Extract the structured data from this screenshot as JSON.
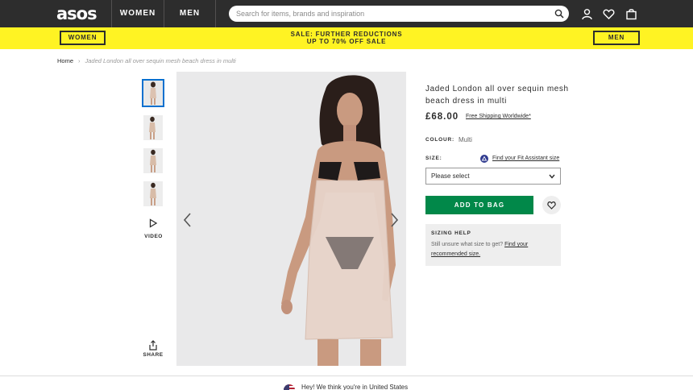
{
  "header": {
    "logo": "asos",
    "tabs": [
      "WOMEN",
      "MEN"
    ],
    "search_placeholder": "Search for items, brands and inspiration",
    "icons": [
      "account-icon",
      "heart-icon",
      "bag-icon"
    ]
  },
  "promo": {
    "women_button": "WOMEN",
    "men_button": "MEN",
    "line1": "SALE: FURTHER REDUCTIONS",
    "line2": "UP TO 70% OFF SALE",
    "background": "#fff323"
  },
  "breadcrumb": {
    "home": "Home",
    "separator": "›",
    "current": "Jaded London all over sequin mesh beach dress in multi"
  },
  "gallery": {
    "thumbnail_count": 4,
    "selected_index": 0,
    "video_label": "VIDEO",
    "share_label": "SHARE"
  },
  "product": {
    "title": "Jaded London all over sequin mesh beach dress in multi",
    "price": "£68.00",
    "shipping_link": "Free Shipping Worldwide*",
    "colour_label": "COLOUR:",
    "colour_value": "Multi",
    "size_label": "SIZE:",
    "fit_assistant_link": "Find your Fit Assistant size",
    "size_select_value": "Please select",
    "add_to_bag": "ADD TO BAG",
    "add_to_bag_color": "#018849"
  },
  "sizing_help": {
    "heading": "SIZING HELP",
    "text": "Still unsure what size to get?",
    "link": "Find your recommended size."
  },
  "footer": {
    "geo_text": "Hey! We think you're in United States"
  }
}
